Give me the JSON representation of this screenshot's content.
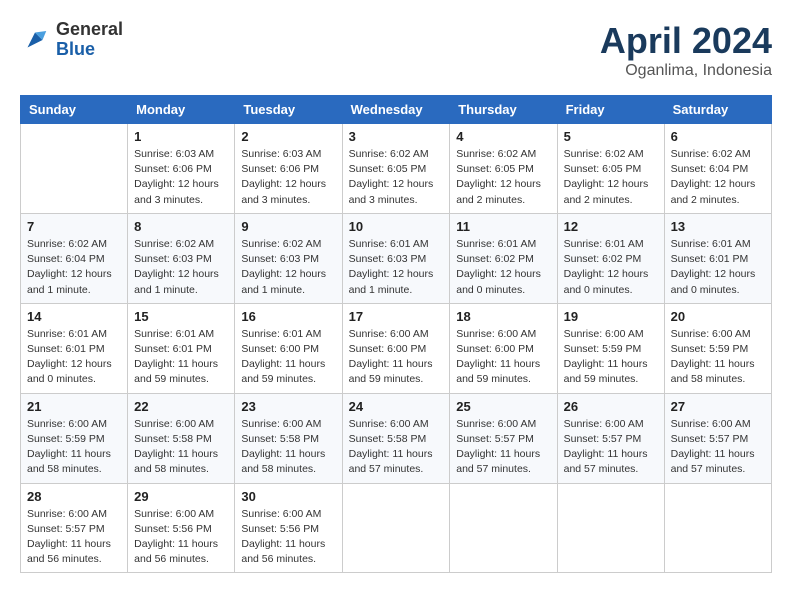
{
  "header": {
    "logo_general": "General",
    "logo_blue": "Blue",
    "month_title": "April 2024",
    "location": "Oganlima, Indonesia"
  },
  "days_of_week": [
    "Sunday",
    "Monday",
    "Tuesday",
    "Wednesday",
    "Thursday",
    "Friday",
    "Saturday"
  ],
  "weeks": [
    [
      {
        "day": "",
        "info": ""
      },
      {
        "day": "1",
        "info": "Sunrise: 6:03 AM\nSunset: 6:06 PM\nDaylight: 12 hours\nand 3 minutes."
      },
      {
        "day": "2",
        "info": "Sunrise: 6:03 AM\nSunset: 6:06 PM\nDaylight: 12 hours\nand 3 minutes."
      },
      {
        "day": "3",
        "info": "Sunrise: 6:02 AM\nSunset: 6:05 PM\nDaylight: 12 hours\nand 3 minutes."
      },
      {
        "day": "4",
        "info": "Sunrise: 6:02 AM\nSunset: 6:05 PM\nDaylight: 12 hours\nand 2 minutes."
      },
      {
        "day": "5",
        "info": "Sunrise: 6:02 AM\nSunset: 6:05 PM\nDaylight: 12 hours\nand 2 minutes."
      },
      {
        "day": "6",
        "info": "Sunrise: 6:02 AM\nSunset: 6:04 PM\nDaylight: 12 hours\nand 2 minutes."
      }
    ],
    [
      {
        "day": "7",
        "info": "Sunrise: 6:02 AM\nSunset: 6:04 PM\nDaylight: 12 hours\nand 1 minute."
      },
      {
        "day": "8",
        "info": "Sunrise: 6:02 AM\nSunset: 6:03 PM\nDaylight: 12 hours\nand 1 minute."
      },
      {
        "day": "9",
        "info": "Sunrise: 6:02 AM\nSunset: 6:03 PM\nDaylight: 12 hours\nand 1 minute."
      },
      {
        "day": "10",
        "info": "Sunrise: 6:01 AM\nSunset: 6:03 PM\nDaylight: 12 hours\nand 1 minute."
      },
      {
        "day": "11",
        "info": "Sunrise: 6:01 AM\nSunset: 6:02 PM\nDaylight: 12 hours\nand 0 minutes."
      },
      {
        "day": "12",
        "info": "Sunrise: 6:01 AM\nSunset: 6:02 PM\nDaylight: 12 hours\nand 0 minutes."
      },
      {
        "day": "13",
        "info": "Sunrise: 6:01 AM\nSunset: 6:01 PM\nDaylight: 12 hours\nand 0 minutes."
      }
    ],
    [
      {
        "day": "14",
        "info": "Sunrise: 6:01 AM\nSunset: 6:01 PM\nDaylight: 12 hours\nand 0 minutes."
      },
      {
        "day": "15",
        "info": "Sunrise: 6:01 AM\nSunset: 6:01 PM\nDaylight: 11 hours\nand 59 minutes."
      },
      {
        "day": "16",
        "info": "Sunrise: 6:01 AM\nSunset: 6:00 PM\nDaylight: 11 hours\nand 59 minutes."
      },
      {
        "day": "17",
        "info": "Sunrise: 6:00 AM\nSunset: 6:00 PM\nDaylight: 11 hours\nand 59 minutes."
      },
      {
        "day": "18",
        "info": "Sunrise: 6:00 AM\nSunset: 6:00 PM\nDaylight: 11 hours\nand 59 minutes."
      },
      {
        "day": "19",
        "info": "Sunrise: 6:00 AM\nSunset: 5:59 PM\nDaylight: 11 hours\nand 59 minutes."
      },
      {
        "day": "20",
        "info": "Sunrise: 6:00 AM\nSunset: 5:59 PM\nDaylight: 11 hours\nand 58 minutes."
      }
    ],
    [
      {
        "day": "21",
        "info": "Sunrise: 6:00 AM\nSunset: 5:59 PM\nDaylight: 11 hours\nand 58 minutes."
      },
      {
        "day": "22",
        "info": "Sunrise: 6:00 AM\nSunset: 5:58 PM\nDaylight: 11 hours\nand 58 minutes."
      },
      {
        "day": "23",
        "info": "Sunrise: 6:00 AM\nSunset: 5:58 PM\nDaylight: 11 hours\nand 58 minutes."
      },
      {
        "day": "24",
        "info": "Sunrise: 6:00 AM\nSunset: 5:58 PM\nDaylight: 11 hours\nand 57 minutes."
      },
      {
        "day": "25",
        "info": "Sunrise: 6:00 AM\nSunset: 5:57 PM\nDaylight: 11 hours\nand 57 minutes."
      },
      {
        "day": "26",
        "info": "Sunrise: 6:00 AM\nSunset: 5:57 PM\nDaylight: 11 hours\nand 57 minutes."
      },
      {
        "day": "27",
        "info": "Sunrise: 6:00 AM\nSunset: 5:57 PM\nDaylight: 11 hours\nand 57 minutes."
      }
    ],
    [
      {
        "day": "28",
        "info": "Sunrise: 6:00 AM\nSunset: 5:57 PM\nDaylight: 11 hours\nand 56 minutes."
      },
      {
        "day": "29",
        "info": "Sunrise: 6:00 AM\nSunset: 5:56 PM\nDaylight: 11 hours\nand 56 minutes."
      },
      {
        "day": "30",
        "info": "Sunrise: 6:00 AM\nSunset: 5:56 PM\nDaylight: 11 hours\nand 56 minutes."
      },
      {
        "day": "",
        "info": ""
      },
      {
        "day": "",
        "info": ""
      },
      {
        "day": "",
        "info": ""
      },
      {
        "day": "",
        "info": ""
      }
    ]
  ]
}
